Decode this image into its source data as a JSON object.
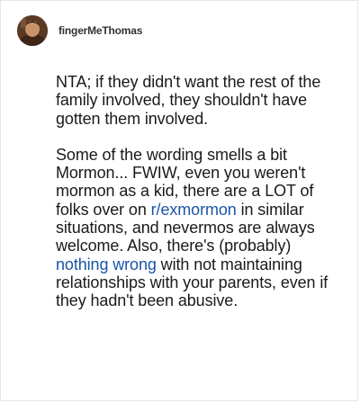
{
  "comment": {
    "author": {
      "username": "fingerMeThomas",
      "avatar_icon": "user-avatar-photo"
    },
    "paragraph1": "NTA; if they didn't want the rest of the family involved, they shouldn't have gotten them involved.",
    "paragraph2": {
      "part1": "Some of the wording smells a bit Mormon... FWIW, even you weren't mormon as a kid, there are a LOT of folks over on ",
      "link1": "r/exmormon",
      "part2": " in similar situations, and nevermos are always welcome. Also, there's (probably) ",
      "link2": "nothing wrong",
      "part3": " with not maintaining relationships with your parents, even if they hadn't been abusive."
    }
  },
  "colors": {
    "link": "#1a55a6",
    "text": "#1a1a1a",
    "border": "#e6e6e6"
  }
}
